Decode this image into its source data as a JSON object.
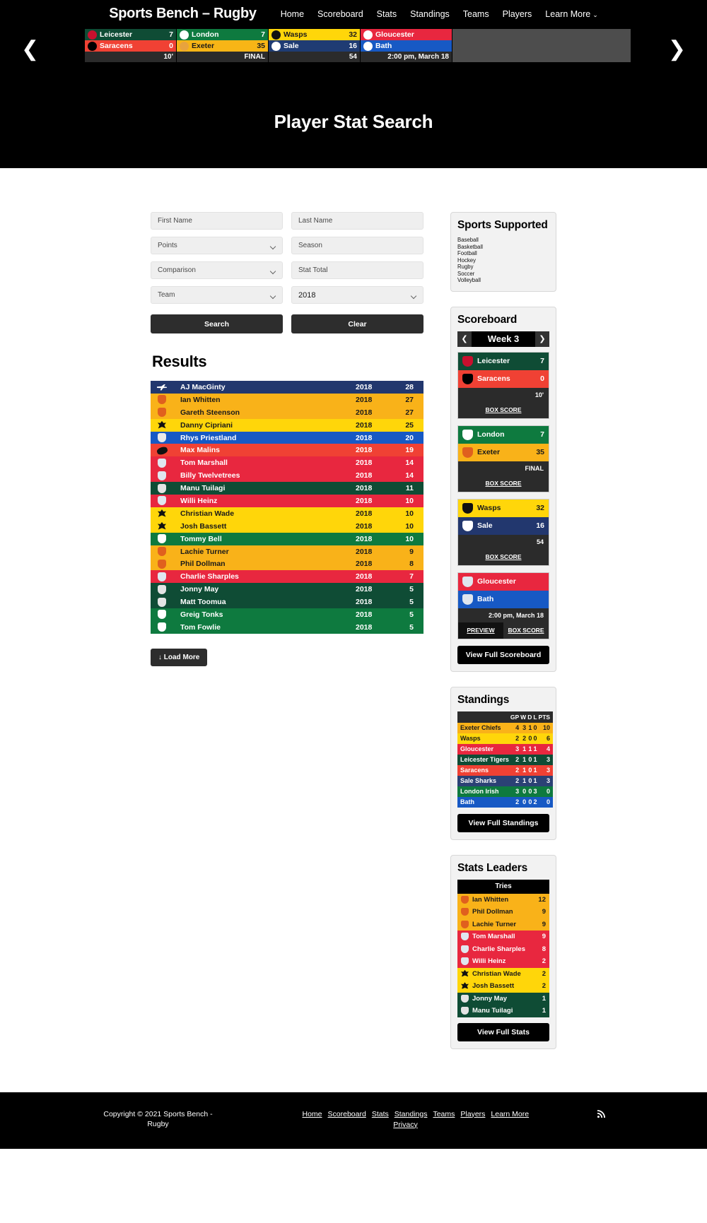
{
  "header": {
    "site_title": "Sports Bench – Rugby",
    "nav": [
      {
        "label": "Home"
      },
      {
        "label": "Scoreboard"
      },
      {
        "label": "Stats"
      },
      {
        "label": "Standings"
      },
      {
        "label": "Teams"
      },
      {
        "label": "Players"
      },
      {
        "label": "Learn More"
      }
    ],
    "nav_caret": "⌄",
    "prev_arrow": "❮",
    "next_arrow": "❯"
  },
  "ticker": [
    {
      "away": {
        "name": "Leicester",
        "score": "7",
        "bg": "#0f4c35",
        "fg": "#ffffff",
        "logo": "#c8102e"
      },
      "home": {
        "name": "Saracens",
        "score": "0",
        "bg": "#f04134",
        "fg": "#ffffff",
        "logo": "#000000"
      },
      "status": "10'"
    },
    {
      "away": {
        "name": "London",
        "score": "7",
        "bg": "#0e7a3f",
        "fg": "#ffffff",
        "logo": "#ffffff"
      },
      "home": {
        "name": "Exeter",
        "score": "35",
        "bg": "#f8b516",
        "fg": "#1a1a1a",
        "logo": "#e8a33d"
      },
      "status": "FINAL"
    },
    {
      "away": {
        "name": "Wasps",
        "score": "32",
        "bg": "#ffd60a",
        "fg": "#1a1a1a",
        "logo": "#111111"
      },
      "home": {
        "name": "Sale",
        "score": "16",
        "bg": "#1f3c73",
        "fg": "#ffffff",
        "logo": "#ffffff"
      },
      "status": "54"
    },
    {
      "away": {
        "name": "Gloucester",
        "score": "",
        "bg": "#e8273f",
        "fg": "#ffffff",
        "logo": "#ffffff"
      },
      "home": {
        "name": "Bath",
        "score": "",
        "bg": "#1759c4",
        "fg": "#ffffff",
        "logo": "#ffffff"
      },
      "status": "2:00 pm, March 18"
    }
  ],
  "hero": {
    "title": "Player Stat Search"
  },
  "search": {
    "first_name_placeholder": "First Name",
    "last_name_placeholder": "Last Name",
    "stat_select": "Points",
    "season_placeholder": "Season",
    "comparison_select": "Comparison",
    "stat_total_placeholder": "Stat Total",
    "team_select": "Team",
    "year_value": "2018",
    "search_label": "Search",
    "clear_label": "Clear"
  },
  "results": {
    "title": "Results",
    "load_more_label": "↓ Load More",
    "rows": [
      {
        "name": "AJ MacGinty",
        "season": "2018",
        "stat": "28",
        "bg": "#22376e",
        "fg": "#ffffff",
        "crest": "#ffffff",
        "shape": "plane"
      },
      {
        "name": "Ian Whitten",
        "season": "2018",
        "stat": "27",
        "bg": "#f9b219",
        "fg": "#1a1a1a",
        "crest": "#e0601e",
        "shape": "round"
      },
      {
        "name": "Gareth Steenson",
        "season": "2018",
        "stat": "27",
        "bg": "#f9b219",
        "fg": "#1a1a1a",
        "crest": "#e0601e",
        "shape": "round"
      },
      {
        "name": "Danny Cipriani",
        "season": "2018",
        "stat": "25",
        "bg": "#ffd60a",
        "fg": "#1a1a1a",
        "crest": "#111111",
        "shape": "wasp"
      },
      {
        "name": "Rhys Priestland",
        "season": "2018",
        "stat": "20",
        "bg": "#1759c4",
        "fg": "#ffffff",
        "crest": "#e9e9e9",
        "shape": "round"
      },
      {
        "name": "Max Malins",
        "season": "2018",
        "stat": "19",
        "bg": "#f04134",
        "fg": "#ffffff",
        "crest": "#111111",
        "shape": "oval"
      },
      {
        "name": "Tom Marshall",
        "season": "2018",
        "stat": "14",
        "bg": "#e8273f",
        "fg": "#ffffff",
        "crest": "#dfe6ef",
        "shape": "round"
      },
      {
        "name": "Billy Twelvetrees",
        "season": "2018",
        "stat": "14",
        "bg": "#e8273f",
        "fg": "#ffffff",
        "crest": "#dfe6ef",
        "shape": "round"
      },
      {
        "name": "Manu Tuilagi",
        "season": "2018",
        "stat": "11",
        "bg": "#0f4c35",
        "fg": "#ffffff",
        "crest": "#e4e4e4",
        "shape": "round"
      },
      {
        "name": "Willi Heinz",
        "season": "2018",
        "stat": "10",
        "bg": "#e8273f",
        "fg": "#ffffff",
        "crest": "#dfe6ef",
        "shape": "round"
      },
      {
        "name": "Christian Wade",
        "season": "2018",
        "stat": "10",
        "bg": "#ffd60a",
        "fg": "#1a1a1a",
        "crest": "#111111",
        "shape": "wasp"
      },
      {
        "name": "Josh Bassett",
        "season": "2018",
        "stat": "10",
        "bg": "#ffd60a",
        "fg": "#1a1a1a",
        "crest": "#111111",
        "shape": "wasp"
      },
      {
        "name": "Tommy Bell",
        "season": "2018",
        "stat": "10",
        "bg": "#0e7a3f",
        "fg": "#ffffff",
        "crest": "#ffffff",
        "shape": "round"
      },
      {
        "name": "Lachie Turner",
        "season": "2018",
        "stat": "9",
        "bg": "#f9b219",
        "fg": "#1a1a1a",
        "crest": "#e0601e",
        "shape": "round"
      },
      {
        "name": "Phil Dollman",
        "season": "2018",
        "stat": "8",
        "bg": "#f9b219",
        "fg": "#1a1a1a",
        "crest": "#e0601e",
        "shape": "round"
      },
      {
        "name": "Charlie Sharples",
        "season": "2018",
        "stat": "7",
        "bg": "#e8273f",
        "fg": "#ffffff",
        "crest": "#dfe6ef",
        "shape": "round"
      },
      {
        "name": "Jonny May",
        "season": "2018",
        "stat": "5",
        "bg": "#0f4c35",
        "fg": "#ffffff",
        "crest": "#e4e4e4",
        "shape": "round"
      },
      {
        "name": "Matt Toomua",
        "season": "2018",
        "stat": "5",
        "bg": "#0f4c35",
        "fg": "#ffffff",
        "crest": "#e4e4e4",
        "shape": "round"
      },
      {
        "name": "Greig Tonks",
        "season": "2018",
        "stat": "5",
        "bg": "#0e7a3f",
        "fg": "#ffffff",
        "crest": "#ffffff",
        "shape": "round"
      },
      {
        "name": "Tom Fowlie",
        "season": "2018",
        "stat": "5",
        "bg": "#0e7a3f",
        "fg": "#ffffff",
        "crest": "#ffffff",
        "shape": "round"
      }
    ]
  },
  "sports_supported": {
    "title": "Sports Supported",
    "items": [
      "Baseball",
      "Basketball",
      "Football",
      "Hockey",
      "Rugby",
      "Soccer",
      "Volleyball"
    ]
  },
  "scoreboard": {
    "title": "Scoreboard",
    "week_label": "Week 3",
    "prev": "❮",
    "next": "❯",
    "box_score_label": "BOX SCORE",
    "preview_label": "PREVIEW",
    "view_full_label": "View Full Scoreboard",
    "games": [
      {
        "away": {
          "name": "Leicester",
          "score": "7",
          "bg": "#0f4c35",
          "fg": "#ffffff",
          "logo": "#c8102e"
        },
        "home": {
          "name": "Saracens",
          "score": "0",
          "bg": "#f04134",
          "fg": "#ffffff",
          "logo": "#000000"
        },
        "status": "10'",
        "links": [
          "BOX SCORE"
        ]
      },
      {
        "away": {
          "name": "London",
          "score": "7",
          "bg": "#0e7a3f",
          "fg": "#ffffff",
          "logo": "#ffffff"
        },
        "home": {
          "name": "Exeter",
          "score": "35",
          "bg": "#f9b219",
          "fg": "#1a1a1a",
          "logo": "#e0601e"
        },
        "status": "FINAL",
        "links": [
          "BOX SCORE"
        ]
      },
      {
        "away": {
          "name": "Wasps",
          "score": "32",
          "bg": "#ffd60a",
          "fg": "#1a1a1a",
          "logo": "#111111"
        },
        "home": {
          "name": "Sale",
          "score": "16",
          "bg": "#22376e",
          "fg": "#ffffff",
          "logo": "#ffffff"
        },
        "status": "54",
        "links": [
          "BOX SCORE"
        ]
      },
      {
        "away": {
          "name": "Gloucester",
          "score": "",
          "bg": "#e8273f",
          "fg": "#ffffff",
          "logo": "#dfe6ef"
        },
        "home": {
          "name": "Bath",
          "score": "",
          "bg": "#1759c4",
          "fg": "#ffffff",
          "logo": "#dfe6ef"
        },
        "status": "2:00 pm, March 18",
        "links": [
          "PREVIEW",
          "BOX SCORE"
        ]
      }
    ]
  },
  "standings": {
    "title": "Standings",
    "columns": [
      "GP",
      "W",
      "D",
      "L",
      "PTS"
    ],
    "view_full_label": "View Full Standings",
    "rows": [
      {
        "team": "Exeter Chiefs",
        "gp": "4",
        "w": "3",
        "d": "1",
        "l": "0",
        "pts": "10",
        "bg": "#f9b219",
        "fg": "#1a1a1a"
      },
      {
        "team": "Wasps",
        "gp": "2",
        "w": "2",
        "d": "0",
        "l": "0",
        "pts": "6",
        "bg": "#ffd60a",
        "fg": "#1a1a1a"
      },
      {
        "team": "Gloucester",
        "gp": "3",
        "w": "1",
        "d": "1",
        "l": "1",
        "pts": "4",
        "bg": "#e8273f",
        "fg": "#ffffff"
      },
      {
        "team": "Leicester Tigers",
        "gp": "2",
        "w": "1",
        "d": "0",
        "l": "1",
        "pts": "3",
        "bg": "#0f4c35",
        "fg": "#ffffff"
      },
      {
        "team": "Saracens",
        "gp": "2",
        "w": "1",
        "d": "0",
        "l": "1",
        "pts": "3",
        "bg": "#f04134",
        "fg": "#ffffff"
      },
      {
        "team": "Sale Sharks",
        "gp": "2",
        "w": "1",
        "d": "0",
        "l": "1",
        "pts": "3",
        "bg": "#2b4175",
        "fg": "#ffffff"
      },
      {
        "team": "London Irish",
        "gp": "3",
        "w": "0",
        "d": "0",
        "l": "3",
        "pts": "0",
        "bg": "#0e7a3f",
        "fg": "#ffffff"
      },
      {
        "team": "Bath",
        "gp": "2",
        "w": "0",
        "d": "0",
        "l": "2",
        "pts": "0",
        "bg": "#1759c4",
        "fg": "#ffffff"
      }
    ]
  },
  "stats_leaders": {
    "title": "Stats Leaders",
    "category": "Tries",
    "view_full_label": "View Full Stats",
    "rows": [
      {
        "name": "Ian Whitten",
        "value": "12",
        "bg": "#f9b219",
        "fg": "#1a1a1a",
        "crest": "#e0601e",
        "shape": "round"
      },
      {
        "name": "Phil Dollman",
        "value": "9",
        "bg": "#f9b219",
        "fg": "#1a1a1a",
        "crest": "#e0601e",
        "shape": "round"
      },
      {
        "name": "Lachie Turner",
        "value": "9",
        "bg": "#f9b219",
        "fg": "#1a1a1a",
        "crest": "#e0601e",
        "shape": "round"
      },
      {
        "name": "Tom Marshall",
        "value": "9",
        "bg": "#e8273f",
        "fg": "#ffffff",
        "crest": "#dfe6ef",
        "shape": "round"
      },
      {
        "name": "Charlie Sharples",
        "value": "8",
        "bg": "#e8273f",
        "fg": "#ffffff",
        "crest": "#dfe6ef",
        "shape": "round"
      },
      {
        "name": "Willi Heinz",
        "value": "2",
        "bg": "#e8273f",
        "fg": "#ffffff",
        "crest": "#dfe6ef",
        "shape": "round"
      },
      {
        "name": "Christian Wade",
        "value": "2",
        "bg": "#ffd60a",
        "fg": "#1a1a1a",
        "crest": "#111111",
        "shape": "wasp"
      },
      {
        "name": "Josh Bassett",
        "value": "2",
        "bg": "#ffd60a",
        "fg": "#1a1a1a",
        "crest": "#111111",
        "shape": "wasp"
      },
      {
        "name": "Jonny May",
        "value": "1",
        "bg": "#0f4c35",
        "fg": "#ffffff",
        "crest": "#e4e4e4",
        "shape": "round"
      },
      {
        "name": "Manu Tuilagi",
        "value": "1",
        "bg": "#0f4c35",
        "fg": "#ffffff",
        "crest": "#e4e4e4",
        "shape": "round"
      }
    ]
  },
  "footer": {
    "copyright": "Copyright © 2021 Sports Bench - Rugby",
    "links": [
      "Home",
      "Scoreboard",
      "Stats",
      "Standings",
      "Teams",
      "Players",
      "Learn More",
      "Privacy"
    ],
    "rss_icon": "rss-icon"
  }
}
